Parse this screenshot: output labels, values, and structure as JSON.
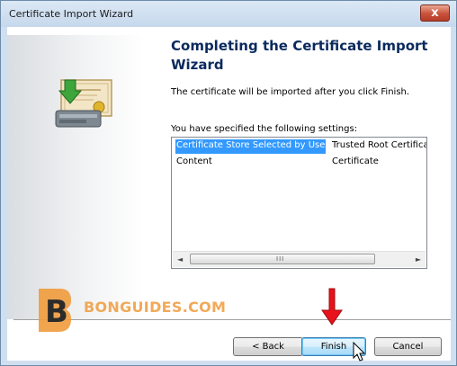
{
  "window": {
    "title": "Certificate Import Wizard",
    "close_glyph": "x"
  },
  "wizard": {
    "heading": "Completing the Certificate Import Wizard",
    "description": "The certificate will be imported after you click Finish.",
    "settings_label": "You have specified the following settings:",
    "settings": [
      {
        "name": "Certificate Store Selected by User",
        "value": "Trusted Root Certifica",
        "selected": true
      },
      {
        "name": "Content",
        "value": "Certificate",
        "selected": false
      }
    ],
    "scroll_left_glyph": "◄",
    "scroll_right_glyph": "►",
    "scroll_grip": "III"
  },
  "buttons": {
    "back": "< Back",
    "finish": "Finish",
    "cancel": "Cancel"
  },
  "watermark": {
    "text": "BONGUIDES.COM",
    "logo_letter": "B",
    "color": "#f09b3c"
  },
  "icons": [
    "close-icon",
    "certificate-import-icon",
    "scroll-left-icon",
    "scroll-right-icon",
    "red-arrow-icon",
    "mouse-cursor-icon"
  ],
  "colors": {
    "selection": "#3399ff",
    "heading": "#0a2a5e",
    "annotation_arrow": "#e8121c"
  }
}
